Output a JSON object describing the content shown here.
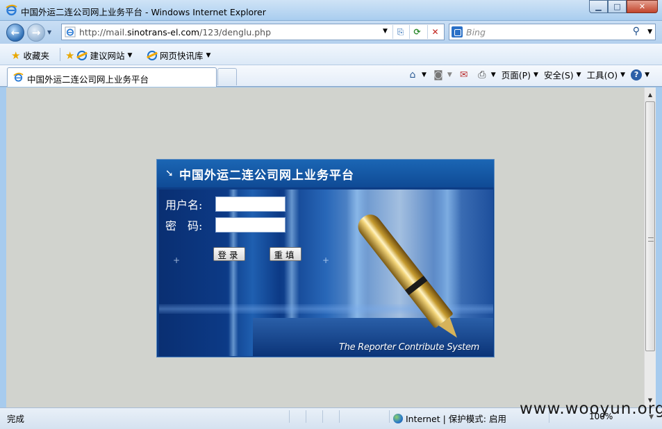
{
  "window": {
    "title": "中国外运二连公司网上业务平台 - Windows Internet Explorer",
    "min_glyph": "▁",
    "max_glyph": "□",
    "close_glyph": "✕"
  },
  "address": {
    "url_prefix": "http://mail.",
    "url_domain": "sinotrans-el.com",
    "url_path": "/123/denglu.php",
    "compat_glyph": "⎘",
    "refresh_glyph": "⟳",
    "stop_glyph": "✕"
  },
  "search": {
    "placeholder": "Bing",
    "glyph": "⚲"
  },
  "favorites_bar": {
    "favorites_label": "收藏夹",
    "items": [
      {
        "label": "建议网站"
      },
      {
        "label": "网页快讯库"
      }
    ]
  },
  "tab": {
    "label": "中国外运二连公司网上业务平台"
  },
  "command_bar": {
    "page_label": "页面(P)",
    "safety_label": "安全(S)",
    "tools_label": "工具(O)",
    "help_glyph": "?",
    "home_glyph": "⌂",
    "feeds_glyph": "◙",
    "mail_glyph": "✉",
    "print_glyph": "⎙"
  },
  "login": {
    "title": "中国外运二连公司网上业务平台",
    "username_label": "用户名:",
    "password_label": "密　码:",
    "username_value": "",
    "password_value": "",
    "login_button": "登录",
    "reset_button": "重填",
    "slogan": "The Reporter Contribute System"
  },
  "status": {
    "text": "完成",
    "zone": "Internet | 保护模式: 启用",
    "zoom": "100%"
  },
  "watermark": "www.wooyun.org"
}
